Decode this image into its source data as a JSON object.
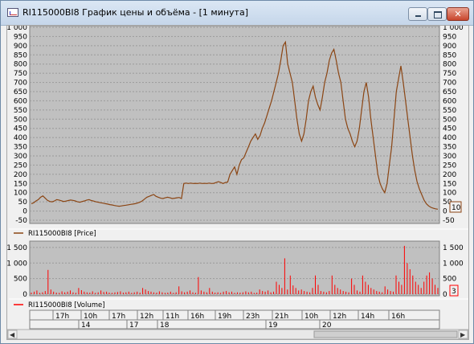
{
  "window": {
    "title": "RI115000BI8 График цены и объёма - [1 минута]",
    "controls": {
      "minimize": "minimize",
      "maximize": "maximize",
      "close": "✕"
    }
  },
  "chart_data": [
    {
      "type": "line",
      "series": [
        {
          "name": "RI115000BI8 [Price]",
          "color": "#8b4513",
          "values": [
            40,
            45,
            55,
            62,
            75,
            82,
            70,
            58,
            52,
            50,
            55,
            62,
            60,
            56,
            52,
            54,
            57,
            60,
            58,
            55,
            50,
            48,
            52,
            55,
            60,
            62,
            57,
            54,
            50,
            48,
            45,
            43,
            40,
            38,
            35,
            33,
            30,
            28,
            26,
            28,
            30,
            32,
            34,
            36,
            38,
            40,
            44,
            48,
            55,
            65,
            75,
            80,
            85,
            90,
            80,
            75,
            70,
            68,
            72,
            75,
            72,
            68,
            70,
            72,
            74,
            68,
            150,
            152,
            150,
            152,
            150,
            151,
            150,
            152,
            150,
            151,
            150,
            152,
            150,
            151,
            155,
            160,
            155,
            150,
            155,
            158,
            200,
            220,
            240,
            200,
            250,
            280,
            290,
            320,
            350,
            380,
            400,
            420,
            390,
            410,
            450,
            480,
            520,
            560,
            600,
            650,
            700,
            750,
            820,
            900,
            920,
            800,
            750,
            700,
            600,
            500,
            420,
            380,
            420,
            500,
            600,
            650,
            680,
            620,
            580,
            550,
            620,
            700,
            750,
            820,
            860,
            880,
            820,
            750,
            700,
            600,
            500,
            450,
            420,
            380,
            350,
            380,
            450,
            550,
            650,
            700,
            620,
            500,
            400,
            300,
            200,
            150,
            120,
            100,
            150,
            250,
            350,
            500,
            650,
            720,
            790,
            700,
            600,
            500,
            400,
            300,
            220,
            160,
            120,
            90,
            60,
            40,
            28,
            20,
            15,
            12,
            10
          ],
          "last_value": "10"
        }
      ],
      "ylim": [
        -50,
        1000
      ],
      "y_ticks": [
        "1 000",
        "950",
        "900",
        "850",
        "800",
        "750",
        "700",
        "650",
        "600",
        "550",
        "500",
        "450",
        "400",
        "350",
        "300",
        "250",
        "200",
        "150",
        "100",
        "50",
        "0",
        "-50"
      ],
      "grid": true
    },
    {
      "type": "bar",
      "series": [
        {
          "name": "RI115000BI8 [Volume]",
          "color": "#ff0000",
          "values": [
            50,
            80,
            120,
            40,
            60,
            100,
            780,
            150,
            80,
            50,
            40,
            90,
            60,
            80,
            120,
            60,
            40,
            200,
            130,
            80,
            60,
            50,
            90,
            40,
            60,
            120,
            70,
            80,
            50,
            40,
            60,
            70,
            90,
            50,
            60,
            80,
            40,
            60,
            80,
            50,
            200,
            150,
            100,
            80,
            60,
            50,
            90,
            60,
            40,
            50,
            80,
            40,
            60,
            250,
            90,
            60,
            80,
            120,
            60,
            40,
            550,
            120,
            80,
            60,
            200,
            80,
            50,
            60,
            40,
            80,
            100,
            60,
            80,
            40,
            60,
            50,
            60,
            90,
            60,
            80,
            40,
            50,
            150,
            100,
            80,
            120,
            60,
            80,
            400,
            300,
            200,
            1150,
            150,
            600,
            280,
            200,
            120,
            150,
            100,
            80,
            60,
            200,
            600,
            300,
            100,
            80,
            60,
            100,
            600,
            300,
            200,
            150,
            100,
            80,
            60,
            500,
            300,
            120,
            80,
            600,
            400,
            300,
            200,
            150,
            100,
            80,
            60,
            250,
            150,
            100,
            80,
            600,
            400,
            300,
            1550,
            1000,
            800,
            600,
            400,
            300,
            200,
            400,
            600,
            700,
            500,
            300,
            200
          ],
          "last_value": "3"
        }
      ],
      "ylim": [
        0,
        1600
      ],
      "y_ticks": [
        "1 500",
        "1 000",
        "500",
        "0"
      ],
      "grid": true
    }
  ],
  "time_axis": {
    "row1": [
      "17h",
      "10h",
      "17h",
      "12h",
      "11h",
      "16h",
      "19h",
      "23h",
      "21h",
      "10h",
      "12h",
      "14h",
      "16h"
    ],
    "row2": [
      "14",
      "17",
      "18",
      "19",
      "20"
    ]
  }
}
